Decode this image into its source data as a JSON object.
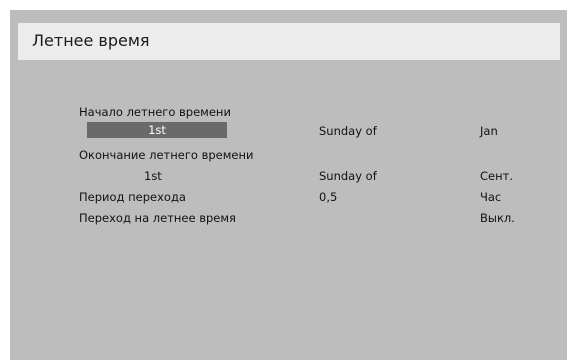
{
  "window": {
    "title": "Летнее время"
  },
  "settings": {
    "dst_start": {
      "label": "Начало летнего времени",
      "week": "1st",
      "day": "Sunday of",
      "month": "Jan"
    },
    "dst_end": {
      "label": "Окончание летнего времени",
      "week": "1st",
      "day": "Sunday of",
      "month": "Сент."
    },
    "transition_period": {
      "label": "Период перехода",
      "value": "0,5",
      "unit": "Час"
    },
    "dst_switch": {
      "label": "Переход на летнее время",
      "value": "Выкл."
    }
  }
}
